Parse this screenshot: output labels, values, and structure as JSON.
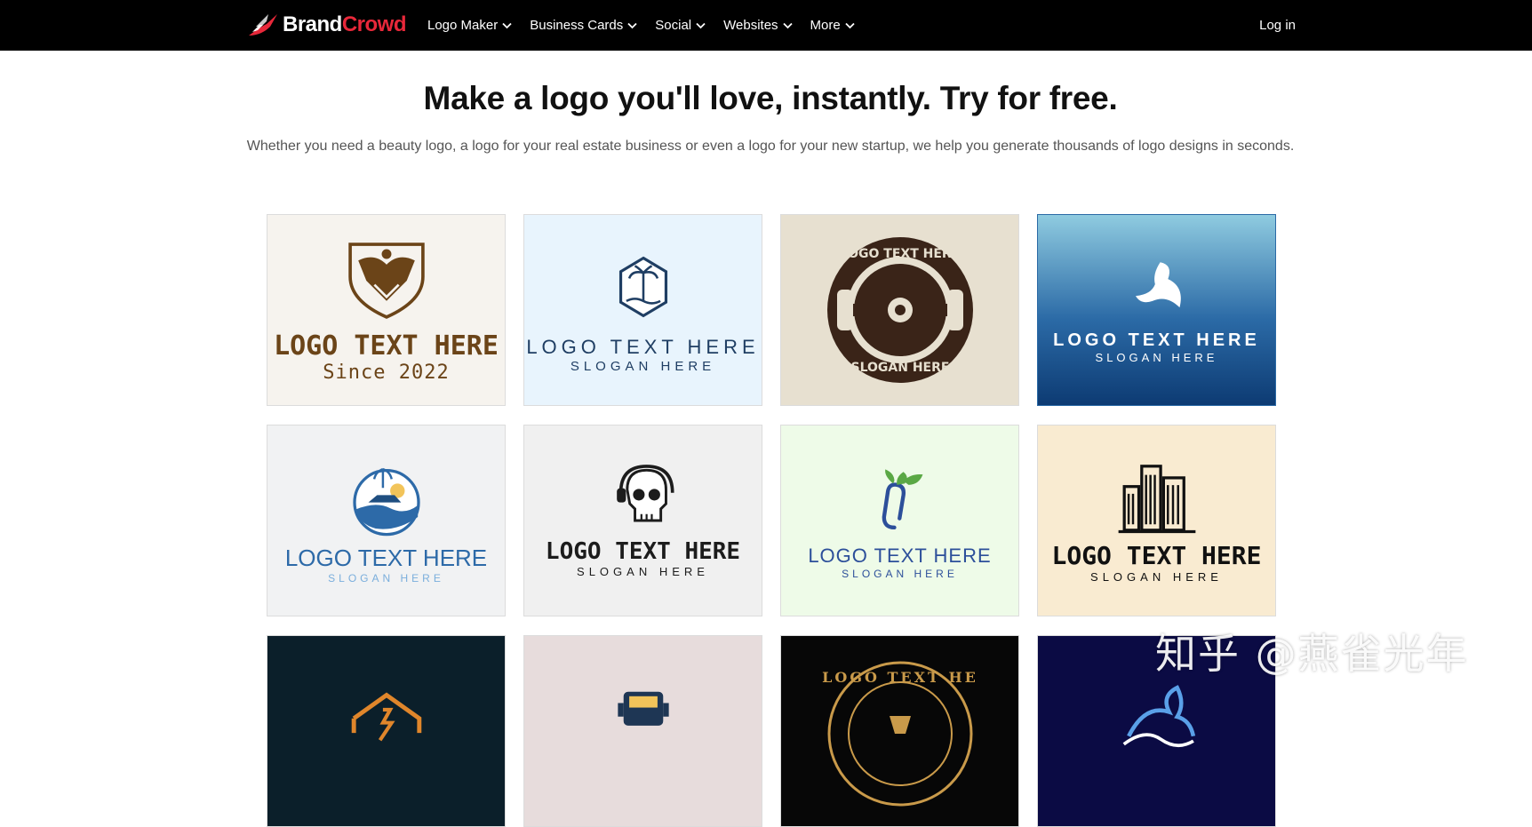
{
  "header": {
    "brand_part1": "Brand",
    "brand_part2": "Crowd",
    "nav": [
      "Logo Maker",
      "Business Cards",
      "Social",
      "Websites",
      "More"
    ],
    "login": "Log in"
  },
  "hero": {
    "title": "Make a logo you'll love, instantly. Try for free.",
    "subtitle": "Whether you need a beauty logo, a logo for your real estate business or even a logo for your new startup, we help you generate thousands of logo designs in seconds."
  },
  "logos": [
    {
      "name": "LOGO TEXT HERE",
      "tagline": "Since 2022",
      "bg": "#f6f3ee",
      "color": "#6b4418",
      "icon": "eagle-shield-icon"
    },
    {
      "name": "LOGO TEXT HERE",
      "tagline": "SLOGAN HERE",
      "bg": "#e8f4fd",
      "color": "#1f3e63",
      "icon": "palm-badge-icon"
    },
    {
      "name": "",
      "tagline": "",
      "bg": "#e7e0d0",
      "color": "#3a2418",
      "icon": "barbell-seal-icon",
      "ring_top": "LOGO TEXT HERE",
      "ring_bottom": "SLOGAN HERE"
    },
    {
      "name": "LOGO TEXT HERE",
      "tagline": "SLOGAN HERE",
      "bg": "#3f7fb3",
      "color": "#ffffff",
      "icon": "bird-icon"
    },
    {
      "name": "LOGO TEXT HERE",
      "tagline": "SLOGAN HERE",
      "bg": "#f1f2f3",
      "color": "#2d6aa8",
      "icon": "yacht-wave-icon"
    },
    {
      "name": "LOGO TEXT HERE",
      "tagline": "SLOGAN HERE",
      "bg": "#f0f0f0",
      "color": "#1c1c1c",
      "icon": "skull-headphones-icon"
    },
    {
      "name": "LOGO TEXT HERE",
      "tagline": "SLOGAN HERE",
      "bg": "#eefbe8",
      "color": "#2c4f9a",
      "icon": "paperclip-leaf-icon"
    },
    {
      "name": "LOGO TEXT HERE",
      "tagline": "SLOGAN HERE",
      "bg": "#f9ebd1",
      "color": "#111111",
      "icon": "city-buildings-icon"
    },
    {
      "name": "",
      "tagline": "",
      "bg": "#0b1f2a",
      "color": "#e0862b",
      "icon": "house-outline-icon"
    },
    {
      "name": "",
      "tagline": "",
      "bg": "#e7dcdc",
      "color": "#1e3654",
      "icon": "truck-icon"
    },
    {
      "name": "",
      "tagline": "",
      "bg": "#070707",
      "color": "#c99a4a",
      "icon": "gold-seal-icon",
      "ring_top": "LOGO TEXT HE"
    },
    {
      "name": "",
      "tagline": "",
      "bg": "#0b0b44",
      "color": "#5aa0e8",
      "icon": "wave-figure-icon"
    }
  ],
  "watermark": "知乎 @燕雀光年"
}
